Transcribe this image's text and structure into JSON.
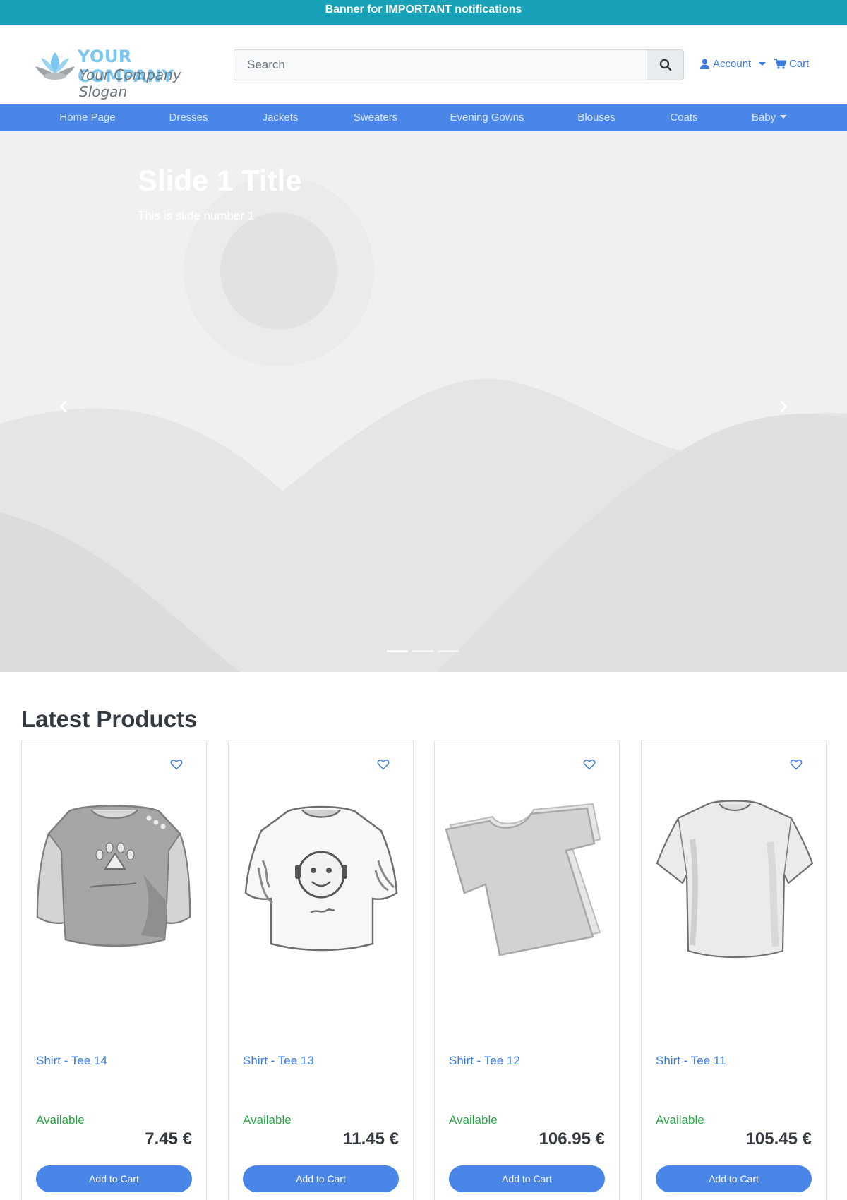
{
  "banner": {
    "text": "Banner for IMPORTANT notifications"
  },
  "header": {
    "company": "YOUR COMPANY",
    "slogan": "Your Company Slogan",
    "search": {
      "placeholder": "Search",
      "value": ""
    },
    "account_label": "Account",
    "cart_label": "Cart"
  },
  "nav": {
    "items": [
      {
        "label": "Home Page"
      },
      {
        "label": "Dresses"
      },
      {
        "label": "Jackets"
      },
      {
        "label": "Sweaters"
      },
      {
        "label": "Evening Gowns"
      },
      {
        "label": "Blouses"
      },
      {
        "label": "Coats"
      },
      {
        "label": "Baby",
        "dropdown": true
      }
    ]
  },
  "carousel": {
    "title": "Slide 1 Title",
    "text": "This is slide number 1",
    "slide_count": 3,
    "active_index": 0
  },
  "products": {
    "title": "Latest Products",
    "items": [
      {
        "name": "Shirt - Tee 14",
        "status": "Available",
        "price": "7.45 €",
        "button": "Add to Cart"
      },
      {
        "name": "Shirt - Tee 13",
        "status": "Available",
        "price": "11.45 €",
        "button": "Add to Cart"
      },
      {
        "name": "Shirt - Tee 12",
        "status": "Available",
        "price": "106.95 €",
        "button": "Add to Cart"
      },
      {
        "name": "Shirt - Tee 11",
        "status": "Available",
        "price": "105.45 €",
        "button": "Add to Cart"
      }
    ]
  },
  "colors": {
    "banner": "#17a2b8",
    "nav": "#4a86e8",
    "link": "#3c7be0",
    "available": "#28a745",
    "button": "#4a86e8"
  }
}
